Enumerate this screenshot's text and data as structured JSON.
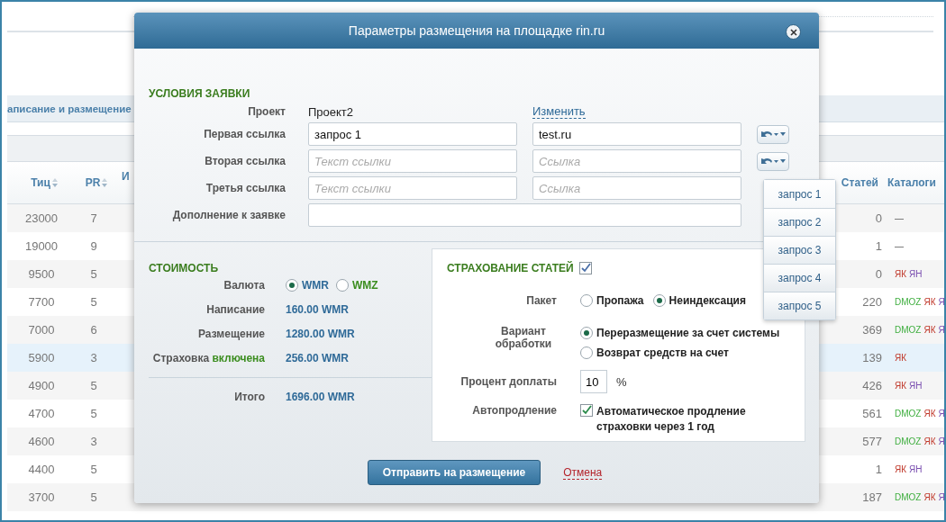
{
  "page": {
    "tab_label": "аписание и размещение",
    "table": {
      "columns": [
        {
          "label": "Тиц",
          "sortable": true
        },
        {
          "label": "PR",
          "sortable": true
        },
        {
          "label": "И",
          "sortable": false
        },
        {
          "label": "Статей",
          "sortable": false
        },
        {
          "label": "Каталоги",
          "sortable": false
        }
      ],
      "rows": [
        {
          "tic": "23000",
          "pr": "7",
          "articles": "0",
          "catalogs": [
            {
              "text": "—"
            }
          ],
          "selected": false
        },
        {
          "tic": "19000",
          "pr": "9",
          "articles": "1",
          "catalogs": [
            {
              "text": "—"
            }
          ],
          "selected": false
        },
        {
          "tic": "9500",
          "pr": "5",
          "articles": "0",
          "catalogs": [
            {
              "text": "ЯК",
              "color": "#c0392b"
            },
            {
              "text": "ЯН",
              "color": "#7b4fb0"
            }
          ],
          "selected": false
        },
        {
          "tic": "7700",
          "pr": "5",
          "articles": "220",
          "catalogs": [
            {
              "text": "DMOZ",
              "color": "#3fae3f"
            },
            {
              "text": "ЯК",
              "color": "#c0392b"
            },
            {
              "text": "Я",
              "color": "#7b4fb0"
            }
          ],
          "selected": false
        },
        {
          "tic": "7000",
          "pr": "6",
          "articles": "369",
          "catalogs": [
            {
              "text": "DMOZ",
              "color": "#3fae3f"
            },
            {
              "text": "ЯК",
              "color": "#c0392b"
            },
            {
              "text": "Я",
              "color": "#7b4fb0"
            }
          ],
          "selected": false
        },
        {
          "tic": "5900",
          "pr": "3",
          "articles": "139",
          "catalogs": [
            {
              "text": "ЯК",
              "color": "#c0392b"
            }
          ],
          "selected": true
        },
        {
          "tic": "4900",
          "pr": "5",
          "articles": "426",
          "catalogs": [
            {
              "text": "ЯК",
              "color": "#c0392b"
            },
            {
              "text": "ЯН",
              "color": "#7b4fb0"
            }
          ],
          "selected": false
        },
        {
          "tic": "4700",
          "pr": "5",
          "articles": "561",
          "catalogs": [
            {
              "text": "DMOZ",
              "color": "#3fae3f"
            },
            {
              "text": "ЯК",
              "color": "#c0392b"
            },
            {
              "text": "Я",
              "color": "#7b4fb0"
            }
          ],
          "selected": false
        },
        {
          "tic": "4600",
          "pr": "3",
          "articles": "577",
          "catalogs": [
            {
              "text": "DMOZ",
              "color": "#3fae3f"
            },
            {
              "text": "ЯК",
              "color": "#c0392b"
            },
            {
              "text": "Я",
              "color": "#7b4fb0"
            }
          ],
          "selected": false
        },
        {
          "tic": "4400",
          "pr": "5",
          "articles": "1",
          "catalogs": [
            {
              "text": "ЯК",
              "color": "#c0392b"
            },
            {
              "text": "ЯН",
              "color": "#7b4fb0"
            }
          ],
          "selected": false
        },
        {
          "tic": "3700",
          "pr": "5",
          "articles": "187",
          "catalogs": [
            {
              "text": "DMOZ",
              "color": "#3fae3f"
            },
            {
              "text": "ЯК",
              "color": "#c0392b"
            },
            {
              "text": "Я",
              "color": "#7b4fb0"
            }
          ],
          "selected": false
        }
      ]
    }
  },
  "dialog": {
    "title": "Параметры размещения на площадке rin.ru",
    "conditions": {
      "heading": "УСЛОВИЯ ЗАЯВКИ",
      "project_label": "Проект",
      "project_value": "Проект2",
      "change_link": "Изменить",
      "links": [
        {
          "label": "Первая ссылка",
          "text": {
            "value": "запрос 1"
          },
          "url": {
            "value": "test.ru"
          },
          "undo_button": true
        },
        {
          "label": "Вторая ссылка",
          "text": {
            "placeholder": "Текст ссылки"
          },
          "url": {
            "placeholder": "Ссылка"
          },
          "undo_button": true
        },
        {
          "label": "Третья ссылка",
          "text": {
            "placeholder": "Текст ссылки"
          },
          "url": {
            "placeholder": "Ссылка"
          },
          "undo_button": false
        }
      ],
      "note_label": "Дополнение к заявке"
    },
    "menu": {
      "items": [
        {
          "label": "запрос 1"
        },
        {
          "label": "запрос 2"
        },
        {
          "label": "запрос 3"
        },
        {
          "label": "запрос 4"
        },
        {
          "label": "запрос 5"
        }
      ]
    },
    "cost": {
      "heading": "СТОИМОСТЬ",
      "currency_label": "Валюта",
      "currencies": [
        {
          "label": "WMR",
          "selected": true
        },
        {
          "label": "WMZ",
          "selected": false
        }
      ],
      "lines": [
        {
          "label": "Написание",
          "value": "160.00 WMR"
        },
        {
          "label": "Размещение",
          "value": "1280.00 WMR"
        },
        {
          "label": "Страховка",
          "status": "включена",
          "value": "256.00 WMR"
        }
      ],
      "total": {
        "label": "Итого",
        "value": "1696.00 WMR"
      }
    },
    "insurance": {
      "heading": "СТРАХОВАНИЕ СТАТЕЙ",
      "checked": true,
      "package_label": "Пакет",
      "packages": [
        {
          "label": "Пропажа",
          "selected": false
        },
        {
          "label": "Неиндексация",
          "selected": true
        }
      ],
      "handling_label": "Вариант обработки",
      "handling": [
        {
          "label": "Переразмещение за счет системы",
          "selected": true
        },
        {
          "label": "Возврат средств на счет",
          "selected": false
        }
      ],
      "percent_label": "Процент доплаты",
      "percent_value": "10",
      "percent_unit": "%",
      "renewal_label": "Автопродление",
      "renewal": {
        "label": "Автоматическое продление страховки через 1 год",
        "checked": true
      }
    },
    "actions": {
      "submit": "Отправить на размещение",
      "cancel": "Отмена"
    }
  }
}
